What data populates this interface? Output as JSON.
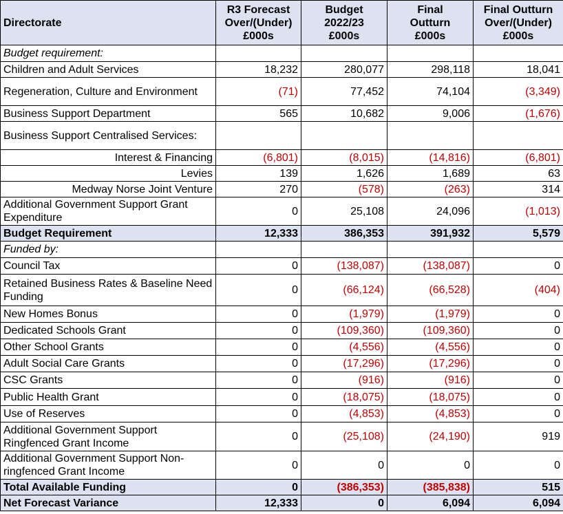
{
  "headers": {
    "directorate": "Directorate",
    "r3": [
      "R3 Forecast",
      "Over/(Under)",
      "£000s"
    ],
    "budget": [
      "Budget",
      "2022/23",
      "£000s"
    ],
    "final": [
      "Final",
      "Outturn",
      "£000s"
    ],
    "outturn_var": [
      "Final Outturn",
      "Over/(Under)",
      "£000s"
    ]
  },
  "rows": [
    {
      "label": "Budget requirement:",
      "style": "section",
      "values": [
        "",
        "",
        "",
        ""
      ]
    },
    {
      "label": "Children and Adult Services",
      "values": [
        "18,232",
        "280,077",
        "298,118",
        "18,041"
      ]
    },
    {
      "label": "Regeneration, Culture and Environment",
      "values": [
        "(71)",
        "77,452",
        "74,104",
        "(3,349)"
      ]
    },
    {
      "label": "Business Support Department",
      "values": [
        "565",
        "10,682",
        "9,006",
        "(1,676)"
      ]
    },
    {
      "label": "Business Support Centralised Services:",
      "values": [
        "",
        "",
        "",
        ""
      ]
    },
    {
      "label": "Interest & Financing",
      "style": "indent",
      "values": [
        "(6,801)",
        "(8,015)",
        "(14,816)",
        "(6,801)"
      ]
    },
    {
      "label": "Levies",
      "style": "indent",
      "values": [
        "139",
        "1,626",
        "1,689",
        "63"
      ]
    },
    {
      "label": "Medway Norse Joint Venture",
      "style": "indent",
      "values": [
        "270",
        "(578)",
        "(263)",
        "314"
      ]
    },
    {
      "label": "Additional Government Support Grant Expenditure",
      "values": [
        "0",
        "25,108",
        "24,096",
        "(1,013)"
      ]
    },
    {
      "label": "Budget Requirement",
      "style": "total",
      "values": [
        "12,333",
        "386,353",
        "391,932",
        "5,579"
      ]
    },
    {
      "label": "Funded by:",
      "style": "section",
      "values": [
        "",
        "",
        "",
        ""
      ]
    },
    {
      "label": "Council Tax",
      "values": [
        "0",
        "(138,087)",
        "(138,087)",
        "0"
      ]
    },
    {
      "label": "Retained Business Rates & Baseline Need Funding",
      "values": [
        "0",
        "(66,124)",
        "(66,528)",
        "(404)"
      ]
    },
    {
      "label": "New Homes Bonus",
      "values": [
        "0",
        "(1,979)",
        "(1,979)",
        "0"
      ]
    },
    {
      "label": "Dedicated Schools Grant",
      "values": [
        "0",
        "(109,360)",
        "(109,360)",
        "0"
      ]
    },
    {
      "label": "Other School Grants",
      "values": [
        "0",
        "(4,556)",
        "(4,556)",
        "0"
      ]
    },
    {
      "label": "Adult Social Care Grants",
      "values": [
        "0",
        "(17,296)",
        "(17,296)",
        "0"
      ]
    },
    {
      "label": "CSC Grants",
      "values": [
        "0",
        "(916)",
        "(916)",
        "0"
      ]
    },
    {
      "label": "Public Health Grant",
      "values": [
        "0",
        "(18,075)",
        "(18,075)",
        "0"
      ]
    },
    {
      "label": "Use of Reserves",
      "values": [
        "0",
        "(4,853)",
        "(4,853)",
        "0"
      ]
    },
    {
      "label": "Additional Government Support Ringfenced Grant Income",
      "values": [
        "0",
        "(25,108)",
        "(24,190)",
        "919"
      ]
    },
    {
      "label": "Additional Government Support Non-ringfenced Grant Income",
      "values": [
        "0",
        "0",
        "0",
        "0"
      ]
    },
    {
      "label": "Total Available Funding",
      "style": "total",
      "values": [
        "0",
        "(386,353)",
        "(385,838)",
        "515"
      ]
    },
    {
      "label": "Net Forecast Variance",
      "style": "total",
      "values": [
        "12,333",
        "0",
        "6,094",
        "6,094"
      ]
    }
  ]
}
